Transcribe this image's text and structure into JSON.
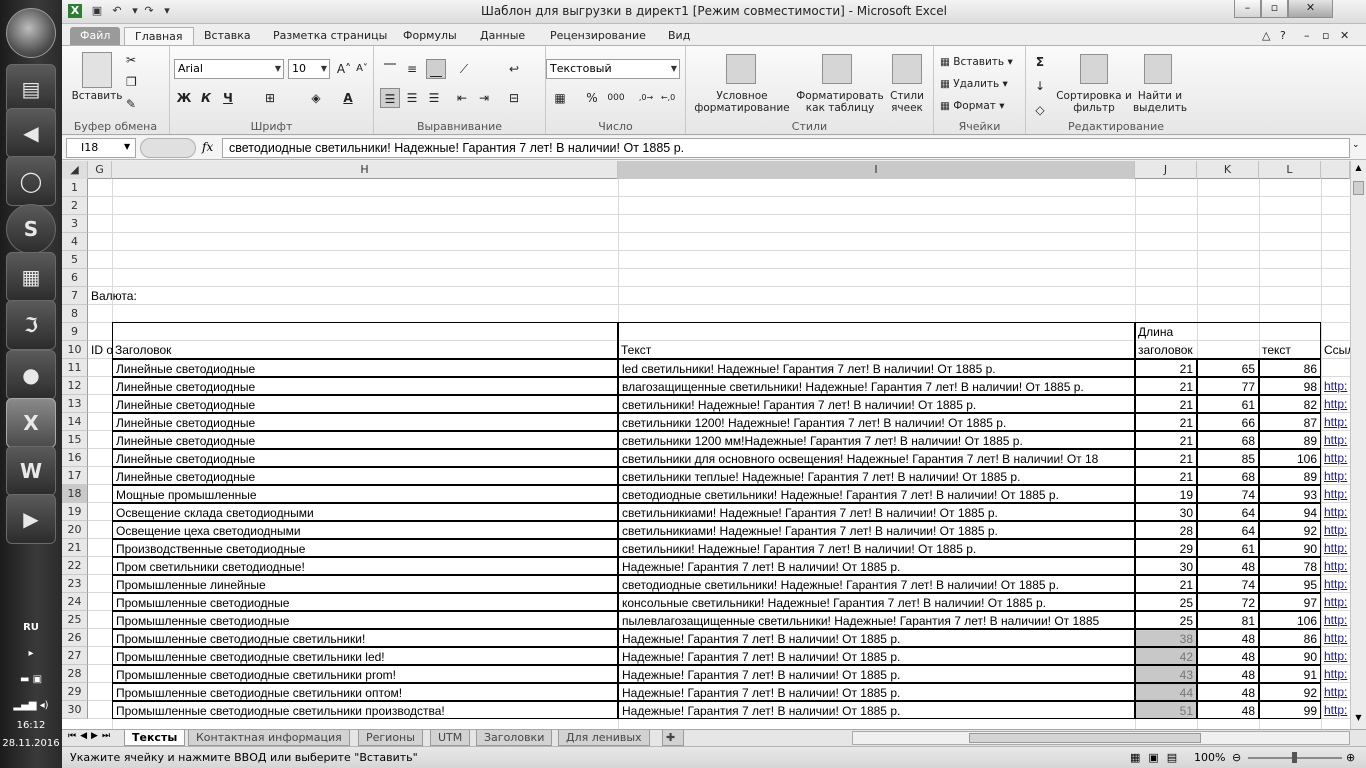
{
  "taskbar": {
    "lang": "RU",
    "time": "16:12",
    "date": "28.11.2016",
    "icons": [
      "start-orb",
      "folder-icon",
      "speaker-icon",
      "browser-icon",
      "skype-icon",
      "calculator-icon",
      "acrobat-icon",
      "disc-icon",
      "excel-icon",
      "word-icon",
      "media-icon"
    ]
  },
  "window": {
    "title": "Шаблон для выгрузки в директ1  [Режим совместимости]  -  Microsoft Excel"
  },
  "ribbon_tabs": [
    "Файл",
    "Главная",
    "Вставка",
    "Разметка страницы",
    "Формулы",
    "Данные",
    "Рецензирование",
    "Вид"
  ],
  "ribbon": {
    "clipboard": {
      "paste": "Вставить",
      "label": "Буфер обмена"
    },
    "font": {
      "name": "Arial",
      "size": "10",
      "bold": "Ж",
      "italic": "К",
      "underline": "Ч",
      "label": "Шрифт"
    },
    "alignment": {
      "label": "Выравнивание"
    },
    "number": {
      "format": "Текстовый",
      "percent": "%",
      "thousands": "000",
      "label": "Число"
    },
    "styles": {
      "conditional": "Условное форматирование",
      "as_table": "Форматировать как таблицу",
      "cell_styles": "Стили ячеек",
      "label": "Стили"
    },
    "cells": {
      "insert": "Вставить",
      "delete": "Удалить",
      "format": "Формат",
      "label": "Ячейки"
    },
    "editing": {
      "sort": "Сортировка и фильтр",
      "find": "Найти и выделить",
      "label": "Редактирование"
    }
  },
  "formula_bar": {
    "name_box": "I18",
    "fx": "fx",
    "content": "светодиодные светильники! Надежные! Гарантия 7 лет! В наличии!  От 1885 р."
  },
  "columns": [
    "G",
    "H",
    "I",
    "J",
    "K",
    "L"
  ],
  "sheet": {
    "label_row7": "Валюта:",
    "header_row9": "Длина",
    "headers": {
      "id": "ID о",
      "title": "Заголовок",
      "text": "Текст",
      "len_title": "заголовок",
      "len_text": "текст",
      "link": "Ссыл"
    },
    "rows": [
      {
        "n": "11",
        "title": "Линейные светодиодные",
        "text": "led светильники! Надежные! Гарантия 7 лет! В наличии!  От 1885 р.",
        "j": "21",
        "k": "65",
        "l": "86",
        "link": ""
      },
      {
        "n": "12",
        "title": "Линейные светодиодные",
        "text": "влагозащищенные светильники! Надежные! Гарантия 7 лет! В наличии!  От 1885 р.",
        "j": "21",
        "k": "77",
        "l": "98",
        "link": "http:"
      },
      {
        "n": "13",
        "title": "Линейные светодиодные",
        "text": "светильники! Надежные! Гарантия 7 лет! В наличии!  От 1885 р.",
        "j": "21",
        "k": "61",
        "l": "82",
        "link": "http:"
      },
      {
        "n": "14",
        "title": "Линейные светодиодные",
        "text": "светильники 1200! Надежные! Гарантия 7 лет! В наличии!  От 1885 р.",
        "j": "21",
        "k": "66",
        "l": "87",
        "link": "http:"
      },
      {
        "n": "15",
        "title": "Линейные светодиодные",
        "text": "светильники 1200 мм!Надежные! Гарантия 7 лет! В наличии!  От 1885 р.",
        "j": "21",
        "k": "68",
        "l": "89",
        "link": "http:"
      },
      {
        "n": "16",
        "title": "Линейные светодиодные",
        "text": "светильники для основного освещения! Надежные! Гарантия 7 лет! В наличии!  От 18",
        "j": "21",
        "k": "85",
        "l": "106",
        "link": "http:"
      },
      {
        "n": "17",
        "title": "Линейные светодиодные",
        "text": "светильники теплые! Надежные! Гарантия 7 лет! В наличии!  От 1885 р.",
        "j": "21",
        "k": "68",
        "l": "89",
        "link": "http:"
      },
      {
        "n": "18",
        "title": "Мощные промышленные",
        "text": "светодиодные светильники! Надежные! Гарантия 7 лет! В наличии!  От 1885 р.",
        "j": "19",
        "k": "74",
        "l": "93",
        "link": "http:"
      },
      {
        "n": "19",
        "title": "Освещение склада светодиодными",
        "text": "светильникиами! Надежные! Гарантия 7 лет! В наличии!  От 1885 р.",
        "j": "30",
        "k": "64",
        "l": "94",
        "link": "http:"
      },
      {
        "n": "20",
        "title": "Освещение цеха светодиодными",
        "text": "светильникиами! Надежные! Гарантия 7 лет! В наличии!  От 1885 р.",
        "j": "28",
        "k": "64",
        "l": "92",
        "link": "http:"
      },
      {
        "n": "21",
        "title": "Производственные светодиодные",
        "text": "светильники! Надежные! Гарантия 7 лет! В наличии!  От 1885 р.",
        "j": "29",
        "k": "61",
        "l": "90",
        "link": "http:"
      },
      {
        "n": "22",
        "title": "Пром светильники светодиодные!",
        "text": "Надежные! Гарантия 7 лет! В наличии!  От 1885 р.",
        "j": "30",
        "k": "48",
        "l": "78",
        "link": "http:"
      },
      {
        "n": "23",
        "title": "Промышленные линейные",
        "text": "светодиодные светильники! Надежные! Гарантия 7 лет! В наличии!  От 1885 р.",
        "j": "21",
        "k": "74",
        "l": "95",
        "link": "http:"
      },
      {
        "n": "24",
        "title": "Промышленные светодиодные",
        "text": "консольные светильники! Надежные! Гарантия 7 лет! В наличии!  От 1885 р.",
        "j": "25",
        "k": "72",
        "l": "97",
        "link": "http:"
      },
      {
        "n": "25",
        "title": "Промышленные светодиодные",
        "text": "пылевлагозащищенные светильники! Надежные! Гарантия 7 лет! В наличии!  От 1885",
        "j": "25",
        "k": "81",
        "l": "106",
        "link": "http:"
      },
      {
        "n": "26",
        "title": "Промышленные светодиодные светильники!",
        "text": "Надежные! Гарантия 7 лет! В наличии!  От 1885 р.",
        "j": "38",
        "k": "48",
        "l": "86",
        "link": "http:"
      },
      {
        "n": "27",
        "title": "Промышленные светодиодные светильники led!",
        "text": "Надежные! Гарантия 7 лет! В наличии!  От 1885 р.",
        "j": "42",
        "k": "48",
        "l": "90",
        "link": "http:"
      },
      {
        "n": "28",
        "title": "Промышленные светодиодные светильники prom!",
        "text": "Надежные! Гарантия 7 лет! В наличии!  От 1885 р.",
        "j": "43",
        "k": "48",
        "l": "91",
        "link": "http:"
      },
      {
        "n": "29",
        "title": "Промышленные светодиодные светильники оптом!",
        "text": "Надежные! Гарантия 7 лет! В наличии!  От 1885 р.",
        "j": "44",
        "k": "48",
        "l": "92",
        "link": "http:"
      },
      {
        "n": "30",
        "title": "Промышленные светодиодные светильники производства!",
        "text": "Надежные! Гарантия 7 лет! В наличии!  От 1885 р.",
        "j": "51",
        "k": "48",
        "l": "99",
        "link": "http:"
      }
    ]
  },
  "sheet_tabs": [
    "Тексты",
    "Контактная информация",
    "Регионы",
    "UTM",
    "Заголовки",
    "Для ленивых"
  ],
  "status": {
    "text": "Укажите ячейку и нажмите ВВОД или выберите \"Вставить\"",
    "zoom": "100%"
  }
}
